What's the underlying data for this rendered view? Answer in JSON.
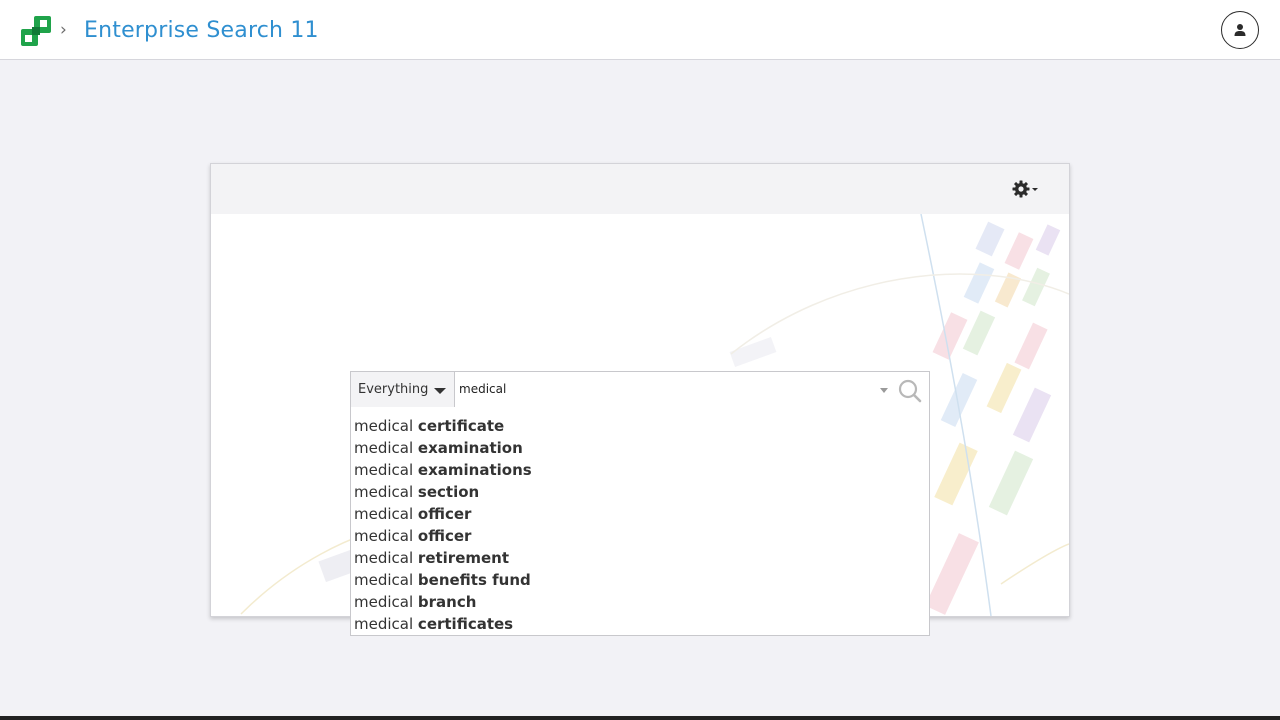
{
  "header": {
    "title": "Enterprise Search 11",
    "logo_icon": "app-logo-icon",
    "breadcrumb_icon": "chevron-right-icon",
    "user_icon": "user-icon",
    "accent": "#2f8fd0"
  },
  "panel": {
    "settings_icon": "gear-icon"
  },
  "search": {
    "scope": "Everything",
    "query": "medical",
    "search_icon": "search-icon"
  },
  "suggestions": [
    {
      "prefix": "medical",
      "completion": "certificate"
    },
    {
      "prefix": "medical",
      "completion": "examination"
    },
    {
      "prefix": "medical",
      "completion": "examinations"
    },
    {
      "prefix": "medical",
      "completion": "section"
    },
    {
      "prefix": "medical",
      "completion": "officer"
    },
    {
      "prefix": "medical",
      "completion": "officer"
    },
    {
      "prefix": "medical",
      "completion": "retirement"
    },
    {
      "prefix": "medical",
      "completion": "benefits fund"
    },
    {
      "prefix": "medical",
      "completion": "branch"
    },
    {
      "prefix": "medical",
      "completion": "certificates"
    }
  ]
}
